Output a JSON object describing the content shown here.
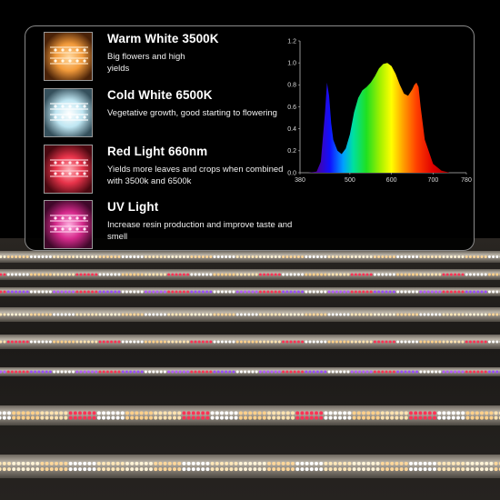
{
  "features": [
    {
      "title": "Warm White 3500K",
      "description": "Big flowers and high yields",
      "color": "#f29a3a",
      "icon": "warm-white-led-icon"
    },
    {
      "title": "Cold White 6500K",
      "description": "Vegetative growth, good starting to flowering",
      "color": "#bfe6f2",
      "icon": "cold-white-led-icon"
    },
    {
      "title": "Red Light 660nm",
      "description": "Yields more leaves and crops when combined with 3500k and 6500k",
      "color": "#e8334a",
      "icon": "red-led-icon"
    },
    {
      "title": "UV Light",
      "description": "Increase resin production and improve taste and smell",
      "color": "#d62a8c",
      "icon": "uv-led-icon"
    }
  ],
  "chart_data": {
    "type": "area",
    "title": "",
    "xlabel": "",
    "ylabel": "",
    "xlim": [
      380,
      780
    ],
    "ylim": [
      0,
      1.2
    ],
    "x_ticks": [
      "380",
      "500",
      "600",
      "700",
      "780"
    ],
    "y_ticks": [
      "0.0",
      "0.2",
      "0.4",
      "0.6",
      "0.8",
      "1.0",
      "1.2"
    ],
    "grid": false,
    "series": [
      {
        "x": [
          380,
          400,
          420,
          430,
          440,
          445,
          450,
          455,
          460,
          470,
          480,
          490,
          500,
          510,
          520,
          530,
          540,
          550,
          560,
          570,
          580,
          590,
          600,
          610,
          620,
          630,
          640,
          650,
          655,
          660,
          665,
          670,
          680,
          700,
          720,
          740,
          760,
          780
        ],
        "y": [
          0.0,
          0.0,
          0.01,
          0.1,
          0.55,
          0.82,
          0.7,
          0.45,
          0.3,
          0.2,
          0.17,
          0.22,
          0.35,
          0.55,
          0.68,
          0.75,
          0.78,
          0.82,
          0.88,
          0.95,
          0.99,
          1.0,
          0.97,
          0.9,
          0.8,
          0.72,
          0.7,
          0.76,
          0.8,
          0.82,
          0.78,
          0.6,
          0.3,
          0.08,
          0.02,
          0.0,
          0.0,
          0.0
        ]
      }
    ]
  },
  "strips": [
    {
      "pattern": "warm"
    },
    {
      "pattern": "red"
    },
    {
      "pattern": "uv"
    },
    {
      "pattern": "warm"
    },
    {
      "pattern": "red"
    },
    {
      "pattern": "uv"
    },
    {
      "pattern": "warm"
    },
    {
      "pattern": "red"
    }
  ]
}
